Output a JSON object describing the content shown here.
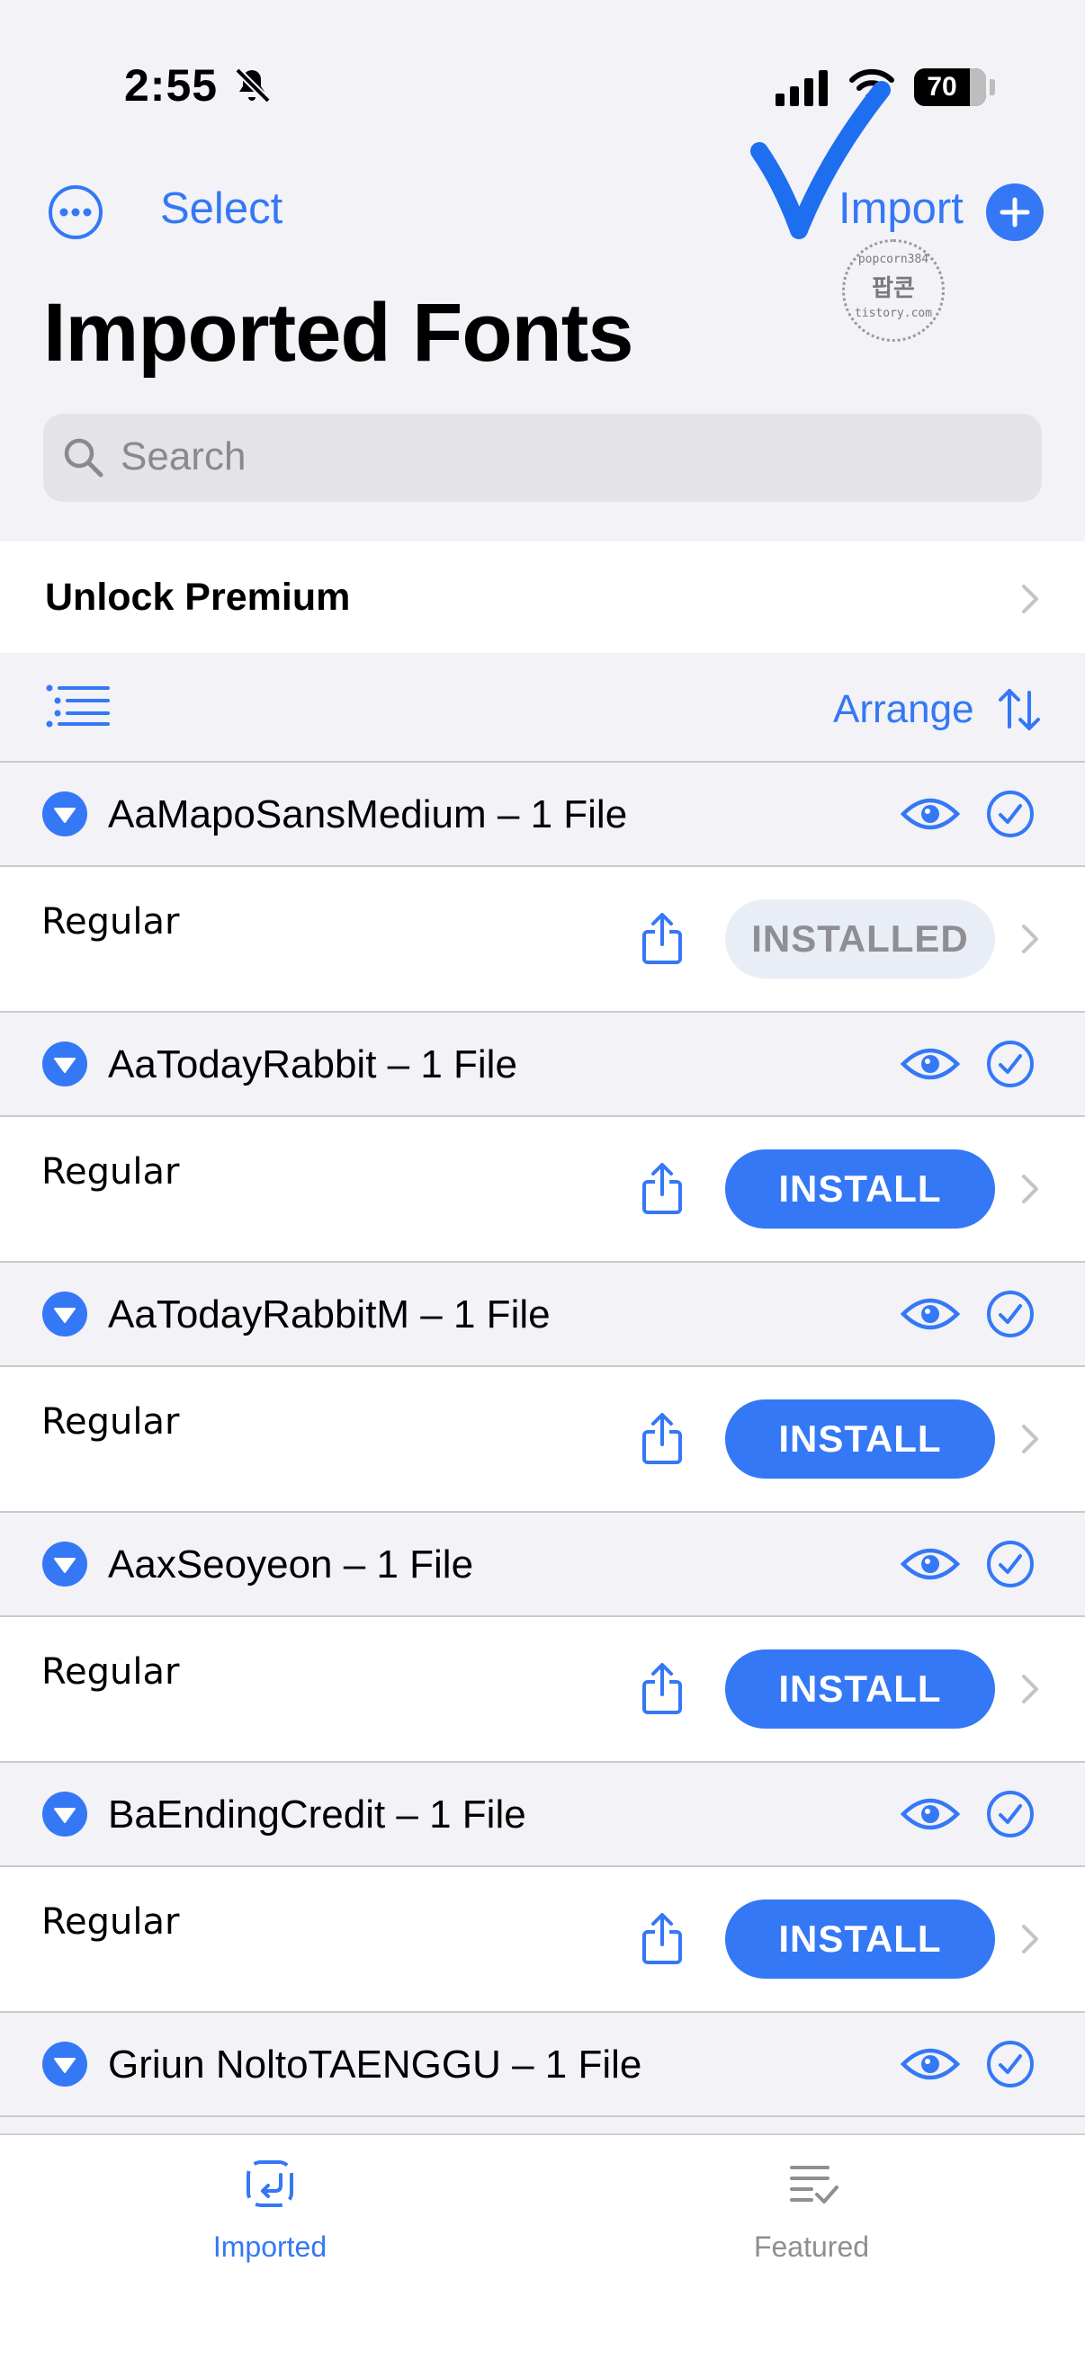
{
  "status_bar": {
    "time": "2:55",
    "battery": "70"
  },
  "nav": {
    "select_label": "Select",
    "import_label": "Import"
  },
  "watermark": {
    "line1": "popcorn384",
    "line2": "팝콘",
    "line3": "tistory.com"
  },
  "page_title": "Imported Fonts",
  "search": {
    "placeholder": "Search"
  },
  "premium": {
    "label": "Unlock Premium"
  },
  "toolbar": {
    "arrange_label": "Arrange"
  },
  "font_groups": [
    {
      "name": "AaMapoSansMedium – 1 File",
      "style": "Regular",
      "button": "INSTALLED",
      "installed": true
    },
    {
      "name": "AaTodayRabbit – 1 File",
      "style": "Regular",
      "button": "INSTALL",
      "installed": false
    },
    {
      "name": "AaTodayRabbitM – 1 File",
      "style": "Regular",
      "button": "INSTALL",
      "installed": false
    },
    {
      "name": "AaxSeoyeon – 1 File",
      "style": "Regular",
      "button": "INSTALL",
      "installed": false
    },
    {
      "name": "BaEndingCredit – 1 File",
      "style": "Regular",
      "button": "INSTALL",
      "installed": false
    },
    {
      "name": "Griun NoltoTAENGGU – 1 File"
    }
  ],
  "tabbar": {
    "imported_label": "Imported",
    "featured_label": "Featured"
  },
  "colors": {
    "accent": "#3478F6",
    "background": "#F2F2F7",
    "muted": "#8E8E93"
  }
}
